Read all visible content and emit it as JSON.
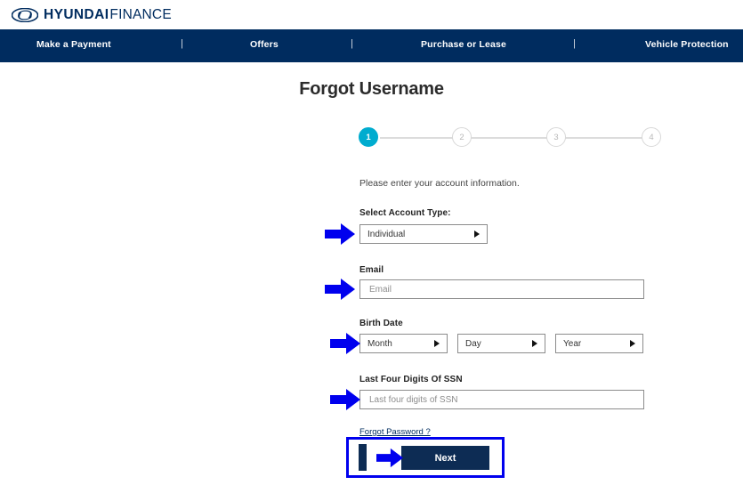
{
  "brand": {
    "logo_icon": "hyundai-h-ellipse-icon",
    "name_bold": "HYUNDAI",
    "name_light": "FINANCE",
    "navy": "#002C5F"
  },
  "navbar": {
    "background": "#002C5F",
    "items": [
      {
        "label": "Make a Payment"
      },
      {
        "label": "Offers"
      },
      {
        "label": "Purchase or Lease"
      },
      {
        "label": "Vehicle Protection"
      }
    ],
    "separator": "|"
  },
  "page": {
    "title": "Forgot Username",
    "intro": "Please enter your account information."
  },
  "stepper": {
    "active_color": "#00ACCF",
    "inactive_color": "#d8d8d8",
    "current_step": 1,
    "steps": [
      {
        "label": "1",
        "state": "active"
      },
      {
        "label": "2",
        "state": "inactive"
      },
      {
        "label": "3",
        "state": "inactive"
      },
      {
        "label": "4",
        "state": "inactive"
      }
    ]
  },
  "form": {
    "account_type": {
      "label": "Select Account Type:",
      "value": "Individual",
      "caret_icon": "caret-right-icon"
    },
    "email": {
      "label": "Email",
      "placeholder": "Email",
      "value": ""
    },
    "birth_date": {
      "label": "Birth Date",
      "month": {
        "value": "Month",
        "caret_icon": "caret-right-icon"
      },
      "day": {
        "value": "Day",
        "caret_icon": "caret-right-icon"
      },
      "year": {
        "value": "Year",
        "caret_icon": "caret-right-icon"
      }
    },
    "ssn": {
      "label": "Last Four Digits Of SSN",
      "placeholder": "Last four digits of SSN",
      "value": ""
    },
    "forgot_password_link": "Forgot Password ?",
    "next_button": "Next"
  },
  "annotations": {
    "arrow_color": "#0000EE",
    "highlight_border_color": "#0000EE",
    "arrow_icon": "right-arrow-annotation-icon",
    "cursor_icon": "text-cursor-bar-icon"
  }
}
